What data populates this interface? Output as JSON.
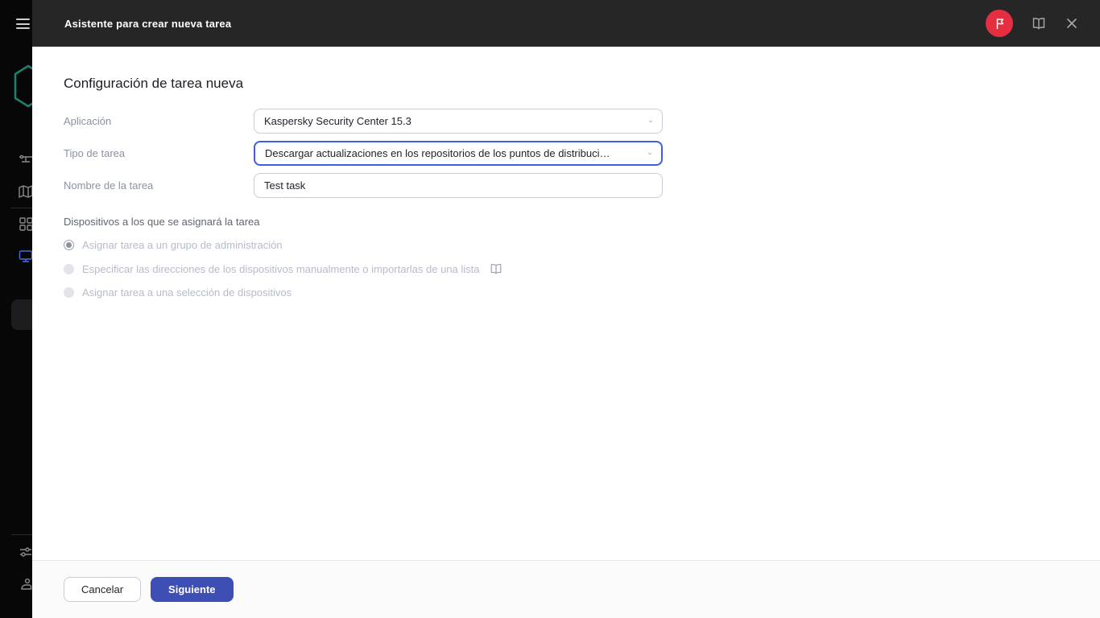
{
  "colors": {
    "header_bg": "#262626",
    "sidebar_bg": "#070708",
    "accent_primary_button": "#3d4eb5",
    "focus_border_blue": "#3d5fe0",
    "active_sidebar_icon": "#4a6ee0",
    "brand_teal": "#1e7f6d",
    "brand_red_badge": "#e62e41"
  },
  "icons": {
    "menu-icon": "hamburger ≡",
    "kaspersky-hexagon-logo": "teal hexagon outline",
    "server-icon": "network node",
    "map-icon": "folded map",
    "grid-icon": "apps grid",
    "monitor-icon": "display (active, blue)",
    "sliders-icon": "settings sliders",
    "user-icon": "person",
    "flag-icon": "white flag in red circle",
    "book-icon": "open book / help",
    "close-icon": "✕",
    "chevron-down-icon": "⌄"
  },
  "header": {
    "title": "Asistente para crear nueva tarea"
  },
  "form": {
    "heading": "Configuración de tarea nueva",
    "fields": [
      {
        "label": "Aplicación",
        "type": "select",
        "value": "Kaspersky Security Center 15.3"
      },
      {
        "label": "Tipo de tarea",
        "type": "select",
        "value": "Descargar actualizaciones en los repositorios de los puntos de distribuci…",
        "focused": true
      },
      {
        "label": "Nombre de la tarea",
        "type": "text",
        "value": "Test task"
      }
    ],
    "devices": {
      "label": "Dispositivos a los que se asignará la tarea",
      "options": [
        {
          "label": "Asignar tarea a un grupo de administración",
          "selected": true,
          "disabled": true
        },
        {
          "label": "Especificar las direcciones de los dispositivos manualmente o importarlas de una lista",
          "selected": false,
          "disabled": true,
          "has_book_icon": true
        },
        {
          "label": "Asignar tarea a una selección de dispositivos",
          "selected": false,
          "disabled": true
        }
      ]
    }
  },
  "footer": {
    "cancel_label": "Cancelar",
    "next_label": "Siguiente"
  }
}
